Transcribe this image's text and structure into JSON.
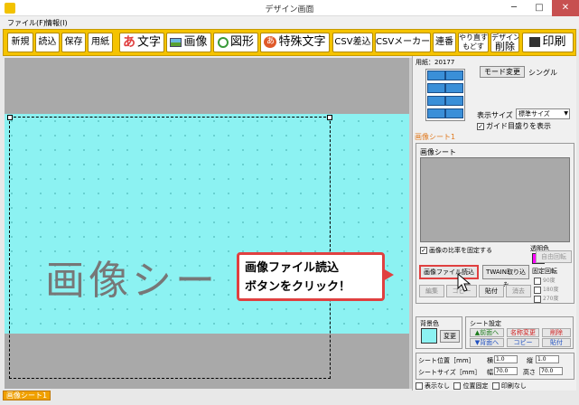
{
  "window": {
    "title": "デザイン画面",
    "min": "─",
    "max": "□",
    "close": "✕"
  },
  "menu": {
    "file": "ファイル(F)",
    "info": "情報(I)"
  },
  "toolbar": {
    "new": "新規",
    "open": "読込",
    "save": "保存",
    "paper": "用紙",
    "text_icon": "あ",
    "text": "文字",
    "image": "画像",
    "shape": "図形",
    "special_icon": "あ",
    "special": "特殊文字",
    "csv_merge": "CSV差込",
    "csv_maker": "CSVメーカー",
    "numbering": "連番",
    "redo_top": "やり直す",
    "redo_bottom": "もどす",
    "design_top": "デザイン",
    "design_bottom": "削除",
    "print": "印刷"
  },
  "canvas": {
    "sheet_label": "画像シー"
  },
  "panel": {
    "paper_label": "用紙：20177",
    "mode_button": "モード変更",
    "mode_value": "シングル",
    "size_label": "表示サイズ",
    "size_value": "標準サイズ",
    "guide_label": "ガイド目盛りを表示",
    "sheet_title": "画像シート1",
    "sheet_group": "画像シート",
    "keep_ratio": "画像の比率を固定する",
    "ratio_line2": "透明色",
    "transparent": "透明色",
    "free_rotate": "自由回転",
    "load_file": "画像ファイル読込",
    "twain": "TWAIN取り込み",
    "fixed_rotate": "固定回転",
    "rot_90": "90度",
    "rot_180": "180度",
    "rot_270": "270度",
    "edit": "編集",
    "copy": "コピー",
    "paste": "貼付",
    "delete": "消去",
    "bg_label": "背景色",
    "bg_change": "変更",
    "sheet_settings": "シート設定",
    "to_front": "▲前面へ",
    "to_back": "▼背面へ",
    "rename": "名称変更",
    "rename_sub": "コピー",
    "remove": "削除",
    "paste2": "貼付",
    "pos_label": "シート位置［mm］",
    "width_short": "横",
    "height_short": "縦",
    "size_label2": "シートサイズ［mm］",
    "w_label": "幅",
    "h_label": "高さ",
    "pos_x": "1.0",
    "pos_y": "1.0",
    "size_w": "70.0",
    "size_h": "70.0",
    "hide": "表示なし",
    "lock_pos": "位置固定",
    "no_print": "印刷なし"
  },
  "callout": {
    "line1": "画像ファイル読込",
    "line2": "ボタンをクリック！"
  },
  "bottom_tab": "画像シート1",
  "colors": {
    "toolbar": "#f5c300",
    "sheet": "#8cf2f2",
    "accent": "#e04040",
    "transparent_swatch": "#ff00ff"
  }
}
